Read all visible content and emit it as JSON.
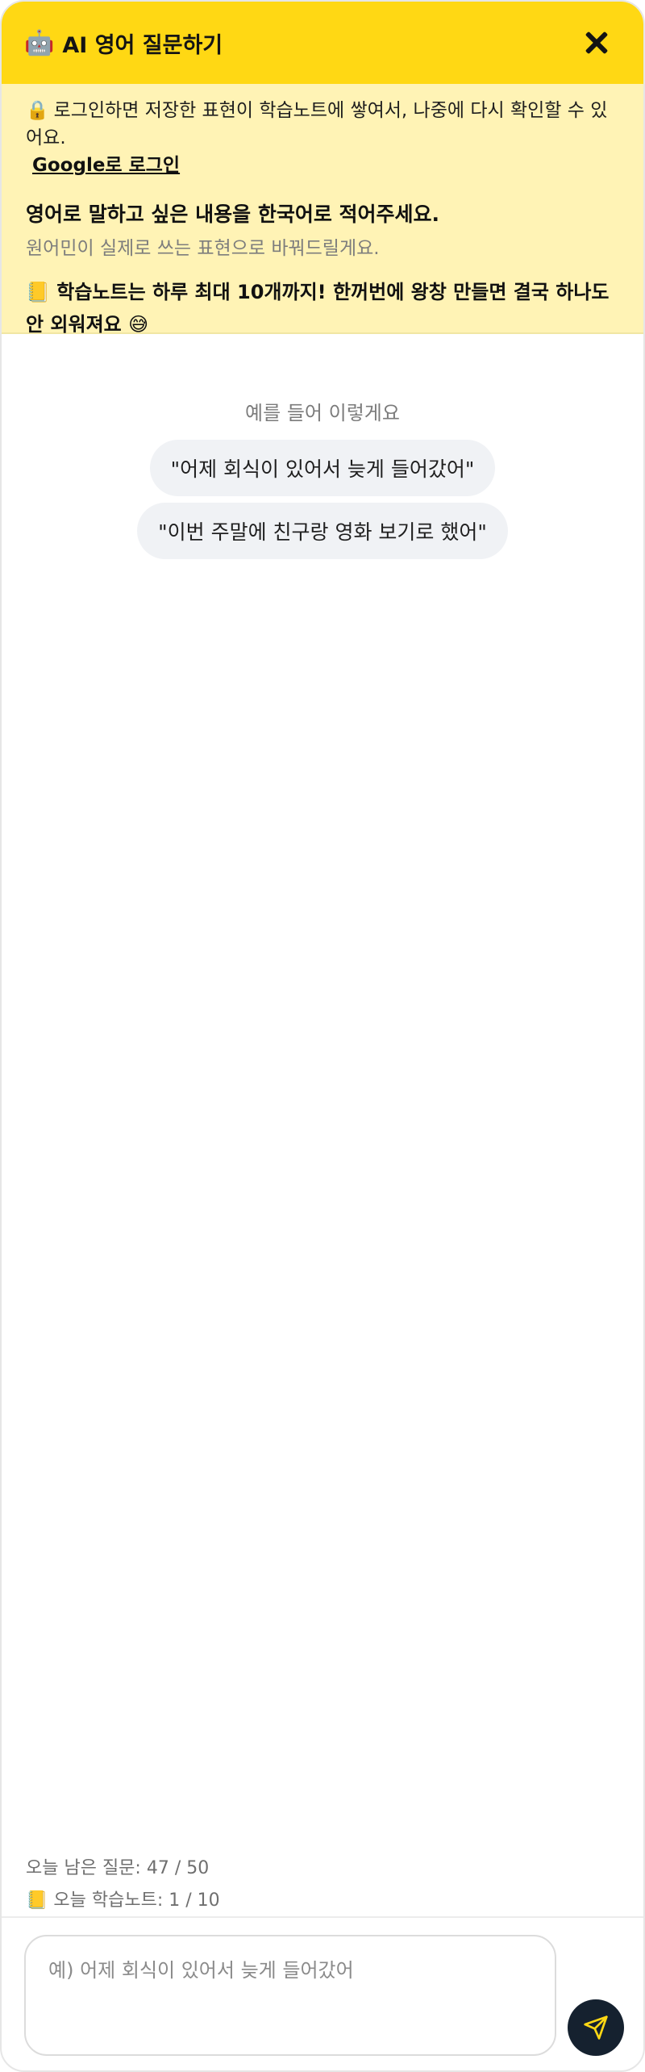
{
  "header": {
    "title": "AI 영어 질문하기",
    "robot_icon": "🤖"
  },
  "info": {
    "lock_icon": "🔒",
    "login_text": "로그인하면 저장한 표현이 학습노트에 쌓여서, 나중에 다시 확인할 수 있어요.",
    "login_link": "Google로 로그인",
    "intro_title": "영어로 말하고 싶은 내용을 한국어로 적어주세요.",
    "intro_sub": "원어민이 실제로 쓰는 표현으로 바꿔드릴게요.",
    "note_icon": "📒",
    "note_text": "학습노트는 하루 최대 10개까지! 한꺼번에 왕창 만들면 결국 하나도 안 외워져요 😅"
  },
  "examples": {
    "label": "예를 들어 이렇게요",
    "items": [
      "\"어제 회식이 있어서 늦게 들어갔어\"",
      "\"이번 주말에 친구랑 영화 보기로 했어\""
    ]
  },
  "counters": {
    "questions": "오늘 남은 질문: 47 / 50",
    "note_icon": "📒",
    "notes": "오늘 학습노트: 1 / 10"
  },
  "input": {
    "placeholder": "예) 어제 회식이 있어서 늦게 들어갔어",
    "value": ""
  },
  "colors": {
    "header_bg": "#ffd814",
    "info_bg": "#fff3b5",
    "send_bg": "#15212f",
    "send_icon": "#ffd814"
  }
}
